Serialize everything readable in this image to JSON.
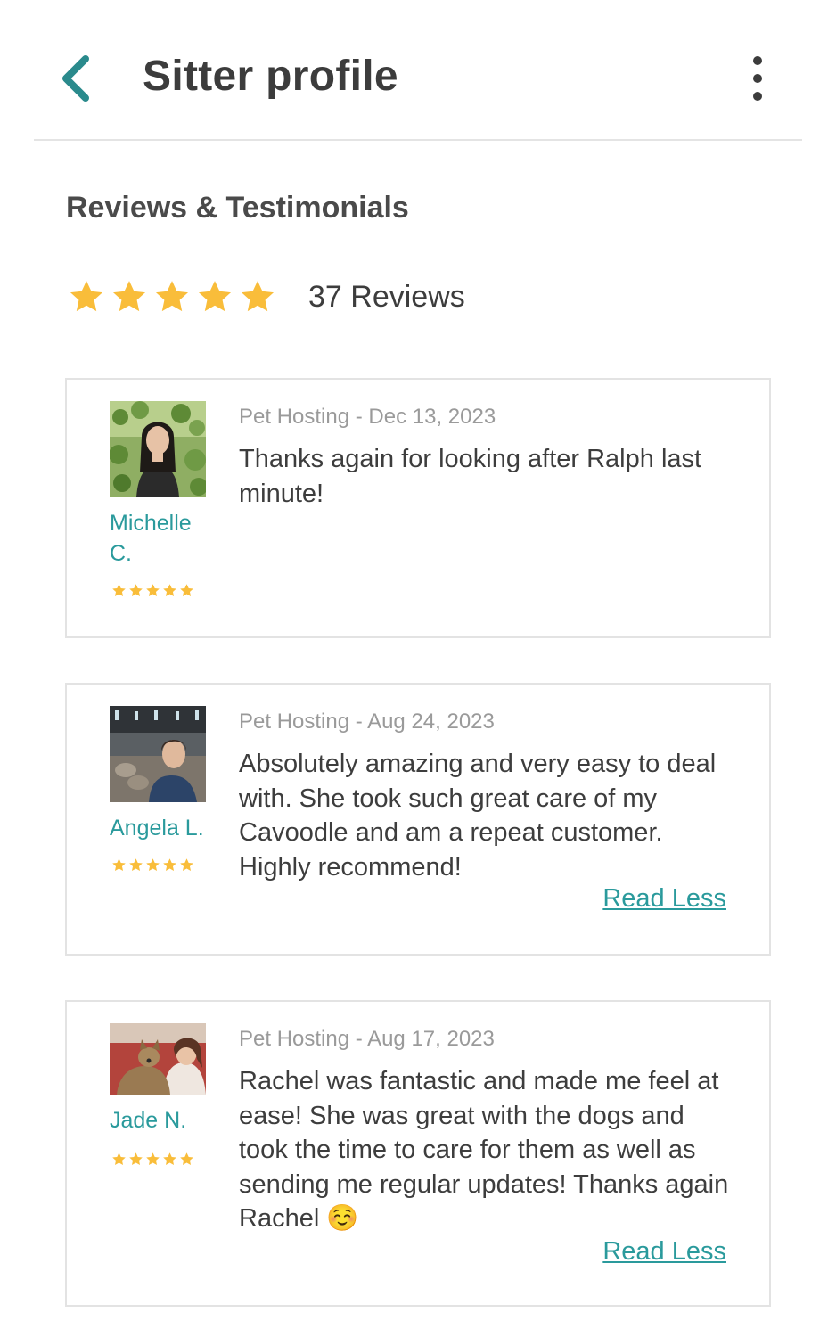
{
  "header": {
    "title": "Sitter profile",
    "back_icon": "chevron-left-icon",
    "more_icon": "more-vertical-icon"
  },
  "section": {
    "title": "Reviews & Testimonials"
  },
  "rating": {
    "stars": 5,
    "max_stars": 5,
    "count_label": "37 Reviews"
  },
  "colors": {
    "accent": "#2a9a9c",
    "star": "#f9bd3a",
    "text": "#3d3d3d",
    "muted": "#9a9a9a",
    "border": "#e3e3e3"
  },
  "reviews": [
    {
      "name_line1": "Michelle",
      "name_line2": "C.",
      "stars": 5,
      "meta": "Pet Hosting - Dec 13, 2023",
      "text": "Thanks again for looking after Ralph last minute!",
      "action": ""
    },
    {
      "name_line1": "Angela L.",
      "stars": 5,
      "meta": "Pet Hosting - Aug 24, 2023",
      "text": "Absolutely amazing and very easy to deal with. She took such great care of my Cavoodle and am a repeat customer. Highly recommend!",
      "action": "Read Less"
    },
    {
      "name_line1": "Jade N.",
      "stars": 5,
      "meta": "Pet Hosting - Aug 17, 2023",
      "text": "Rachel was fantastic and made me feel at ease! She was great with the dogs and took the time to care for them as well as sending me regular updates! Thanks again Rachel ☺️",
      "action": "Read Less"
    }
  ]
}
